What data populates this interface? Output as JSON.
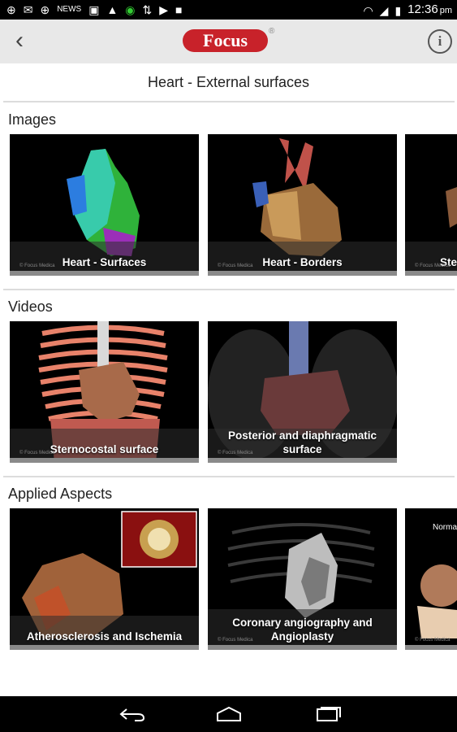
{
  "status": {
    "time": "12:36",
    "time_suffix": "pm",
    "notification_icons": [
      "android-icon",
      "mail-icon",
      "android-icon",
      "news-icon",
      "picture-icon",
      "warning-icon",
      "download-ring-icon",
      "usb-icon",
      "play-store-icon",
      "stop-icon"
    ],
    "system_icons": [
      "wifi-icon",
      "signal-icon",
      "battery-icon"
    ]
  },
  "header": {
    "back_label": "‹",
    "logo_text": "Focus",
    "logo_mark": "®",
    "info_label": "i"
  },
  "page": {
    "title": "Heart - External surfaces"
  },
  "sections": {
    "images": {
      "title": "Images",
      "items": [
        {
          "caption": "Heart - Surfaces",
          "credit": "© Focus Medica"
        },
        {
          "caption": "Heart - Borders",
          "credit": "© Focus Medica"
        },
        {
          "caption": "Ste",
          "credit": "© Focus Medica"
        }
      ]
    },
    "videos": {
      "title": "Videos",
      "items": [
        {
          "caption": "Sternocostal surface",
          "credit": "© Focus Medica"
        },
        {
          "caption": "Posterior and diaphragmatic surface",
          "credit": "© Focus Medica"
        }
      ]
    },
    "applied": {
      "title": "Applied Aspects",
      "items": [
        {
          "caption": "Atherosclerosis and Ischemia",
          "credit": ""
        },
        {
          "caption": "Coronary angiography and Angioplasty",
          "credit": "© Focus Medica"
        },
        {
          "caption": "",
          "top_label": "Norma",
          "credit": "© Focus Medica"
        }
      ]
    }
  },
  "nav": {
    "buttons": [
      "back-nav-icon",
      "home-nav-icon",
      "recents-nav-icon"
    ]
  },
  "colors": {
    "status_bar": "#000000",
    "app_bar": "#e8e8e8",
    "logo_red": "#c8222a",
    "tile_bg": "#000000",
    "caption_bar": "#8a8a8a"
  }
}
